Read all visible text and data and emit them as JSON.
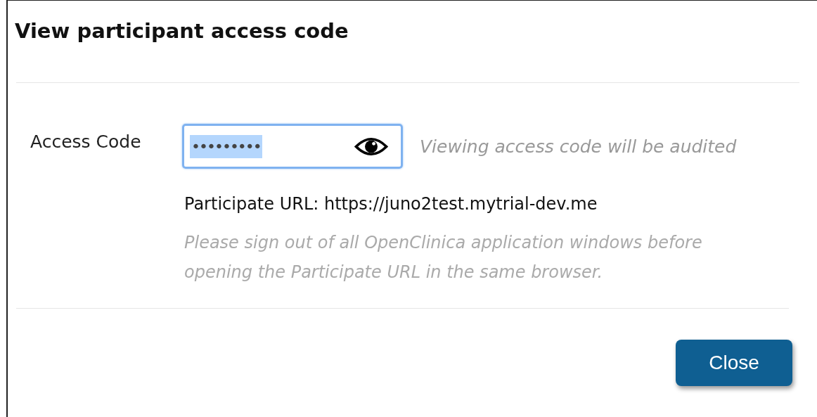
{
  "dialog": {
    "title": "View participant access code"
  },
  "access_code": {
    "label": "Access Code",
    "value": "•••••••••",
    "value_selected": true,
    "hint": "Viewing access code will be audited"
  },
  "participate_url": "Participate URL: https://juno2test.mytrial-dev.me",
  "note": "Please sign out of all OpenClinica application windows before opening the Participate URL in the same browser.",
  "buttons": [
    {
      "label": "Close"
    }
  ]
}
